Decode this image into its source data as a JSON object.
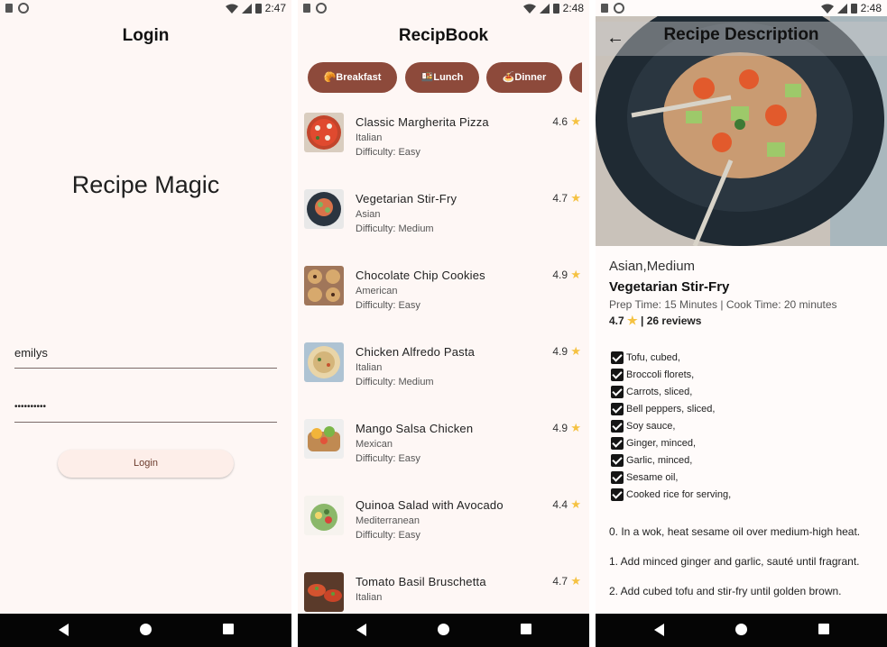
{
  "colors": {
    "accent": "#8d4a3b",
    "background": "#fef7f5",
    "star": "#f5c242"
  },
  "status_times": [
    "2:47",
    "2:48",
    "2:48"
  ],
  "login": {
    "title": "Login",
    "app_name": "Recipe Magic",
    "username_value": "emilys",
    "password_value": "••••••••••",
    "login_button": "Login"
  },
  "book": {
    "title": "RecipBook",
    "categories": [
      {
        "icon": "🥐",
        "label": "Breakfast"
      },
      {
        "icon": "🍱",
        "label": "Lunch"
      },
      {
        "icon": "🍝",
        "label": "Dinner"
      }
    ],
    "recipes": [
      {
        "name": "Classic Margherita Pizza",
        "cuisine": "Italian",
        "difficulty": "Difficulty: Easy",
        "rating": "4.6"
      },
      {
        "name": "Vegetarian Stir-Fry",
        "cuisine": "Asian",
        "difficulty": "Difficulty: Medium",
        "rating": "4.7"
      },
      {
        "name": "Chocolate Chip Cookies",
        "cuisine": "American",
        "difficulty": "Difficulty: Easy",
        "rating": "4.9"
      },
      {
        "name": "Chicken Alfredo Pasta",
        "cuisine": "Italian",
        "difficulty": "Difficulty: Medium",
        "rating": "4.9"
      },
      {
        "name": "Mango Salsa Chicken",
        "cuisine": "Mexican",
        "difficulty": "Difficulty: Easy",
        "rating": "4.9"
      },
      {
        "name": "Quinoa Salad with Avocado",
        "cuisine": "Mediterranean",
        "difficulty": "Difficulty: Easy",
        "rating": "4.4"
      },
      {
        "name": "Tomato Basil Bruschetta",
        "cuisine": "Italian",
        "difficulty": "",
        "rating": "4.7"
      }
    ]
  },
  "detail": {
    "title": "Recipe Description",
    "meta": "Asian,Medium",
    "name": "Vegetarian Stir-Fry",
    "times": "Prep Time: 15 Minutes | Cook Time: 20 minutes",
    "rating": "4.7",
    "reviews": "| 26 reviews",
    "ingredients": [
      "Tofu, cubed,",
      "Broccoli florets,",
      "Carrots, sliced,",
      "Bell peppers, sliced,",
      "Soy sauce,",
      "Ginger, minced,",
      "Garlic, minced,",
      "Sesame oil,",
      "Cooked rice for serving,"
    ],
    "steps": [
      "0. In a wok, heat sesame oil over medium-high heat.",
      "1. Add minced ginger and garlic, sauté until fragrant.",
      "2. Add cubed tofu and stir-fry until golden brown."
    ]
  }
}
